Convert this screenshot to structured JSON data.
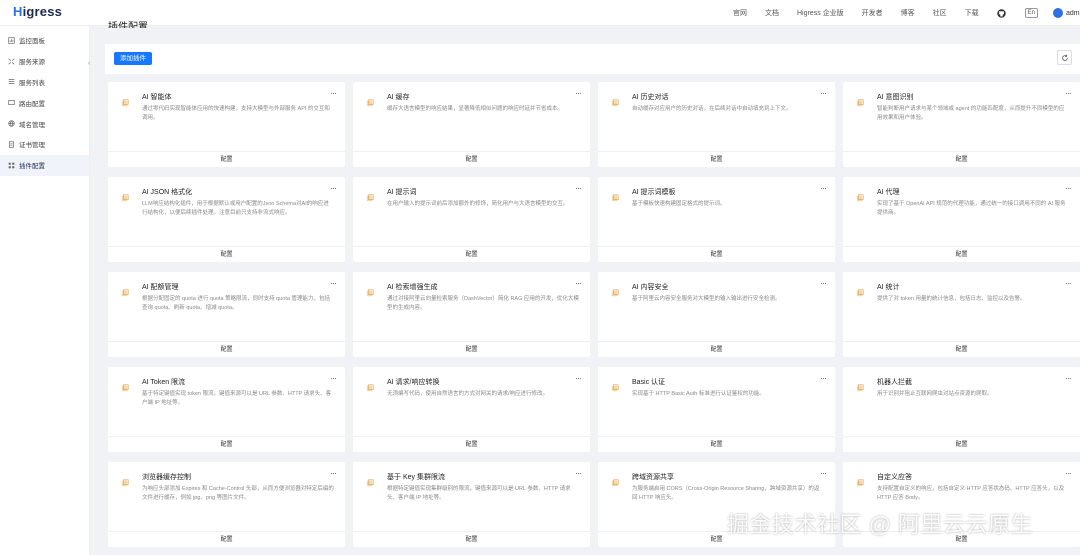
{
  "header": {
    "logo": "Higress",
    "nav": [
      "官网",
      "文档",
      "Higress 企业版",
      "开发者",
      "博客",
      "社区",
      "下载"
    ],
    "lang": "En",
    "user": "admin"
  },
  "sidebar": {
    "items": [
      {
        "label": "监控面板",
        "icon": "dashboard-icon"
      },
      {
        "label": "服务来源",
        "icon": "source-icon"
      },
      {
        "label": "服务列表",
        "icon": "list-icon"
      },
      {
        "label": "路由配置",
        "icon": "route-icon"
      },
      {
        "label": "域名管理",
        "icon": "globe-icon"
      },
      {
        "label": "证书管理",
        "icon": "cert-icon"
      },
      {
        "label": "插件配置",
        "icon": "plugin-icon"
      }
    ],
    "active_index": 6
  },
  "main": {
    "title": "插件配置",
    "add_button": "添加插件",
    "config_label": "配置",
    "more_label": "···"
  },
  "plugins": [
    {
      "title": "AI 智能体",
      "desc": "通过零代码实现智能体应用的快速构建，支持大模型与外部服务 API 的交互和调用。"
    },
    {
      "title": "AI 缓存",
      "desc": "缓存大语言模型的响应结果，显著降低相似问题的响应时延并节省成本。"
    },
    {
      "title": "AI 历史对话",
      "desc": "自动缓存对应用户的历史对话，在后续对话中自动填充到上下文。"
    },
    {
      "title": "AI 意图识别",
      "desc": "智能判断用户请求与某个领域或 agent 的功能匹配度，从而提升不同模型的应用效果和用户体验。"
    },
    {
      "title": "AI JSON 格式化",
      "desc": "LLM响应结构化插件，用于根据默认或用户配置的Json Schema对AI的响应进行结构化，以便后续插件处理。注意目前只支持非流式响应。"
    },
    {
      "title": "AI 提示词",
      "desc": "在用户输入的提示词前后添加额外的修饰，简化用户与大语言模型的交互。"
    },
    {
      "title": "AI 提示词模板",
      "desc": "基于模板快速构建固定格式的提示词。"
    },
    {
      "title": "AI 代理",
      "desc": "实现了基于 OpenAI API 规范的代理功能，通过统一的接口调用不同的 AI 服务提供商。"
    },
    {
      "title": "AI 配额管理",
      "desc": "根据分配固定的 quota 进行 quota 策略限流，同时支持 quota 管理能力，包括查询 quota、刷新 quota、增减 quota。"
    },
    {
      "title": "AI 检索增强生成",
      "desc": "通过对接阿里云向量检索服务（DashVector）简化 RAG 应用的开发，优化大模型的生成内容。"
    },
    {
      "title": "AI 内容安全",
      "desc": "基于阿里云内容安全服务对大模型的输入输出进行安全检测。"
    },
    {
      "title": "AI 统计",
      "desc": "提供了对 token 用量的统计信息，包括日志、监控以及告警。"
    },
    {
      "title": "AI Token 限流",
      "desc": "基于特定键值实现 token 限流，键值来源可以是 URL 参数、HTTP 请求头、客户端 IP 地址等。"
    },
    {
      "title": "AI 请求/响应转换",
      "desc": "无须编写代码，使用自然语言的方式对网关的请求/响应进行修改。"
    },
    {
      "title": "Basic 认证",
      "desc": "实现基于 HTTP Basic Auth 标准进行认证鉴权的功能。"
    },
    {
      "title": "机器人拦截",
      "desc": "用于识别并阻止互联网爬虫对站点资源的爬取。"
    },
    {
      "title": "浏览器缓存控制",
      "desc": "为响应头部添加 Expires 和 Cache-Control 头部，从而方便浏览器对特定后缀的文件进行缓存，例如 jpg、png 等图片文件。"
    },
    {
      "title": "基于 Key 集群限流",
      "desc": "根据特定键值实现集群级别的限流，键值来源可以是 URL 参数、HTTP 请求头、客户端 IP 地址等。"
    },
    {
      "title": "跨域资源共享",
      "desc": "为服务端启用 CORS（Cross-Origin Resource Sharing，跨域资源共享）的返回 HTTP 响应头。"
    },
    {
      "title": "自定义应答",
      "desc": "支持配置自定义的响应，包括自定义 HTTP 应答状态码、HTTP 应答头，以及 HTTP 应答 Body。"
    }
  ],
  "watermark": "掘金技术社区 @ 阿里云云原生"
}
